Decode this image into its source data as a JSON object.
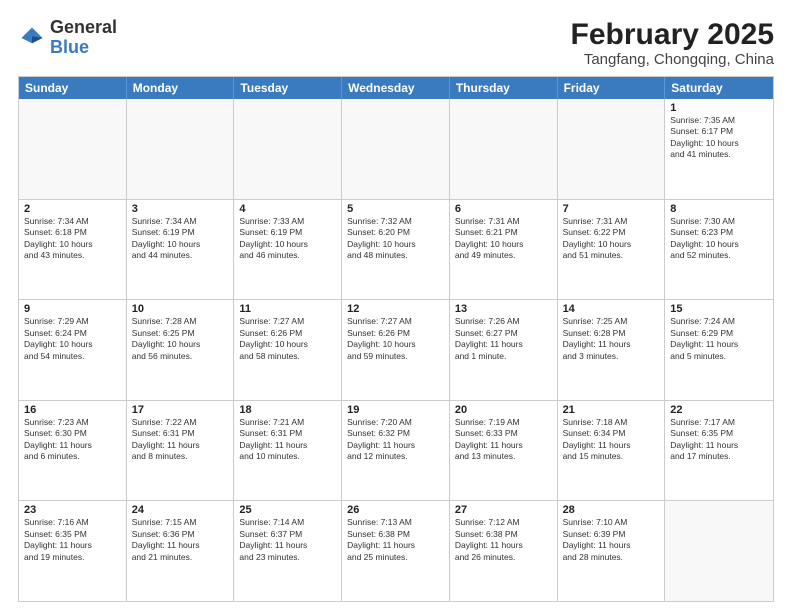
{
  "header": {
    "logo": {
      "general": "General",
      "blue": "Blue"
    },
    "month": "February 2025",
    "location": "Tangfang, Chongqing, China"
  },
  "weekdays": [
    "Sunday",
    "Monday",
    "Tuesday",
    "Wednesday",
    "Thursday",
    "Friday",
    "Saturday"
  ],
  "rows": [
    [
      {
        "day": "",
        "info": ""
      },
      {
        "day": "",
        "info": ""
      },
      {
        "day": "",
        "info": ""
      },
      {
        "day": "",
        "info": ""
      },
      {
        "day": "",
        "info": ""
      },
      {
        "day": "",
        "info": ""
      },
      {
        "day": "1",
        "info": "Sunrise: 7:35 AM\nSunset: 6:17 PM\nDaylight: 10 hours\nand 41 minutes."
      }
    ],
    [
      {
        "day": "2",
        "info": "Sunrise: 7:34 AM\nSunset: 6:18 PM\nDaylight: 10 hours\nand 43 minutes."
      },
      {
        "day": "3",
        "info": "Sunrise: 7:34 AM\nSunset: 6:19 PM\nDaylight: 10 hours\nand 44 minutes."
      },
      {
        "day": "4",
        "info": "Sunrise: 7:33 AM\nSunset: 6:19 PM\nDaylight: 10 hours\nand 46 minutes."
      },
      {
        "day": "5",
        "info": "Sunrise: 7:32 AM\nSunset: 6:20 PM\nDaylight: 10 hours\nand 48 minutes."
      },
      {
        "day": "6",
        "info": "Sunrise: 7:31 AM\nSunset: 6:21 PM\nDaylight: 10 hours\nand 49 minutes."
      },
      {
        "day": "7",
        "info": "Sunrise: 7:31 AM\nSunset: 6:22 PM\nDaylight: 10 hours\nand 51 minutes."
      },
      {
        "day": "8",
        "info": "Sunrise: 7:30 AM\nSunset: 6:23 PM\nDaylight: 10 hours\nand 52 minutes."
      }
    ],
    [
      {
        "day": "9",
        "info": "Sunrise: 7:29 AM\nSunset: 6:24 PM\nDaylight: 10 hours\nand 54 minutes."
      },
      {
        "day": "10",
        "info": "Sunrise: 7:28 AM\nSunset: 6:25 PM\nDaylight: 10 hours\nand 56 minutes."
      },
      {
        "day": "11",
        "info": "Sunrise: 7:27 AM\nSunset: 6:26 PM\nDaylight: 10 hours\nand 58 minutes."
      },
      {
        "day": "12",
        "info": "Sunrise: 7:27 AM\nSunset: 6:26 PM\nDaylight: 10 hours\nand 59 minutes."
      },
      {
        "day": "13",
        "info": "Sunrise: 7:26 AM\nSunset: 6:27 PM\nDaylight: 11 hours\nand 1 minute."
      },
      {
        "day": "14",
        "info": "Sunrise: 7:25 AM\nSunset: 6:28 PM\nDaylight: 11 hours\nand 3 minutes."
      },
      {
        "day": "15",
        "info": "Sunrise: 7:24 AM\nSunset: 6:29 PM\nDaylight: 11 hours\nand 5 minutes."
      }
    ],
    [
      {
        "day": "16",
        "info": "Sunrise: 7:23 AM\nSunset: 6:30 PM\nDaylight: 11 hours\nand 6 minutes."
      },
      {
        "day": "17",
        "info": "Sunrise: 7:22 AM\nSunset: 6:31 PM\nDaylight: 11 hours\nand 8 minutes."
      },
      {
        "day": "18",
        "info": "Sunrise: 7:21 AM\nSunset: 6:31 PM\nDaylight: 11 hours\nand 10 minutes."
      },
      {
        "day": "19",
        "info": "Sunrise: 7:20 AM\nSunset: 6:32 PM\nDaylight: 11 hours\nand 12 minutes."
      },
      {
        "day": "20",
        "info": "Sunrise: 7:19 AM\nSunset: 6:33 PM\nDaylight: 11 hours\nand 13 minutes."
      },
      {
        "day": "21",
        "info": "Sunrise: 7:18 AM\nSunset: 6:34 PM\nDaylight: 11 hours\nand 15 minutes."
      },
      {
        "day": "22",
        "info": "Sunrise: 7:17 AM\nSunset: 6:35 PM\nDaylight: 11 hours\nand 17 minutes."
      }
    ],
    [
      {
        "day": "23",
        "info": "Sunrise: 7:16 AM\nSunset: 6:35 PM\nDaylight: 11 hours\nand 19 minutes."
      },
      {
        "day": "24",
        "info": "Sunrise: 7:15 AM\nSunset: 6:36 PM\nDaylight: 11 hours\nand 21 minutes."
      },
      {
        "day": "25",
        "info": "Sunrise: 7:14 AM\nSunset: 6:37 PM\nDaylight: 11 hours\nand 23 minutes."
      },
      {
        "day": "26",
        "info": "Sunrise: 7:13 AM\nSunset: 6:38 PM\nDaylight: 11 hours\nand 25 minutes."
      },
      {
        "day": "27",
        "info": "Sunrise: 7:12 AM\nSunset: 6:38 PM\nDaylight: 11 hours\nand 26 minutes."
      },
      {
        "day": "28",
        "info": "Sunrise: 7:10 AM\nSunset: 6:39 PM\nDaylight: 11 hours\nand 28 minutes."
      },
      {
        "day": "",
        "info": ""
      }
    ]
  ]
}
